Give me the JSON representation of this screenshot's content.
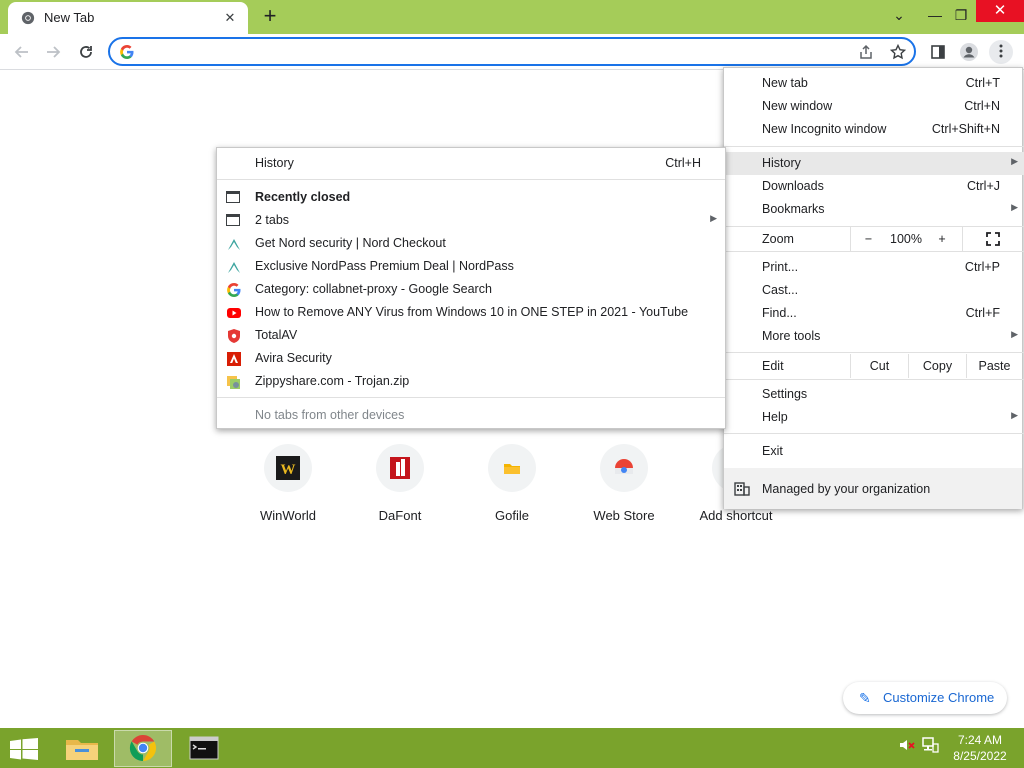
{
  "tab": {
    "title": "New Tab",
    "close": "✕",
    "new_tab": "+"
  },
  "window": {
    "tab_search": "⌄",
    "minimize": "—",
    "restore": "❐",
    "close": "✕"
  },
  "omnibox": {
    "value": "",
    "placeholder": ""
  },
  "shortcuts": [
    {
      "label": "WinWorld",
      "icon": "winworld-icon"
    },
    {
      "label": "DaFont",
      "icon": "dafont-icon"
    },
    {
      "label": "Gofile",
      "icon": "gofile-icon"
    },
    {
      "label": "Web Store",
      "icon": "chrome-web-store-icon"
    },
    {
      "label": "Add shortcut",
      "icon": "plus-icon"
    }
  ],
  "customize": {
    "label": "Customize Chrome"
  },
  "menu": {
    "new_tab": {
      "label": "New tab",
      "accel": "Ctrl+T"
    },
    "new_window": {
      "label": "New window",
      "accel": "Ctrl+N"
    },
    "new_incognito": {
      "label": "New Incognito window",
      "accel": "Ctrl+Shift+N"
    },
    "history": {
      "label": "History"
    },
    "downloads": {
      "label": "Downloads",
      "accel": "Ctrl+J"
    },
    "bookmarks": {
      "label": "Bookmarks"
    },
    "zoom": {
      "label": "Zoom",
      "minus": "−",
      "value": "100%",
      "plus": "+"
    },
    "print": {
      "label": "Print...",
      "accel": "Ctrl+P"
    },
    "cast": {
      "label": "Cast..."
    },
    "find": {
      "label": "Find...",
      "accel": "Ctrl+F"
    },
    "more_tools": {
      "label": "More tools"
    },
    "edit": {
      "label": "Edit",
      "cut": "Cut",
      "copy": "Copy",
      "paste": "Paste"
    },
    "settings": {
      "label": "Settings"
    },
    "help": {
      "label": "Help"
    },
    "exit": {
      "label": "Exit"
    },
    "managed": {
      "label": "Managed by your organization"
    }
  },
  "history_submenu": {
    "history": {
      "label": "History",
      "accel": "Ctrl+H"
    },
    "recently_closed": "Recently closed",
    "items": [
      {
        "label": "2 tabs",
        "icon": "window-icon",
        "submenu": true
      },
      {
        "label": "Get Nord security | Nord Checkout",
        "icon": "nord-icon"
      },
      {
        "label": "Exclusive NordPass Premium Deal | NordPass",
        "icon": "nord-icon"
      },
      {
        "label": "Category: collabnet-proxy - Google Search",
        "icon": "google-icon"
      },
      {
        "label": "How to Remove ANY Virus from Windows 10 in ONE STEP in 2021 - YouTube",
        "icon": "youtube-icon"
      },
      {
        "label": "TotalAV",
        "icon": "totalav-icon"
      },
      {
        "label": "Avira Security",
        "icon": "avira-icon"
      },
      {
        "label": "Zippyshare.com - Trojan.zip",
        "icon": "zippyshare-icon"
      }
    ],
    "no_tabs": "No tabs from other devices"
  },
  "taskbar": {
    "time": "7:24 AM",
    "date": "8/25/2022"
  },
  "colors": {
    "accent": "#1a73e8",
    "tabstrip": "#a5cc59",
    "taskbar": "#7aa32c"
  }
}
